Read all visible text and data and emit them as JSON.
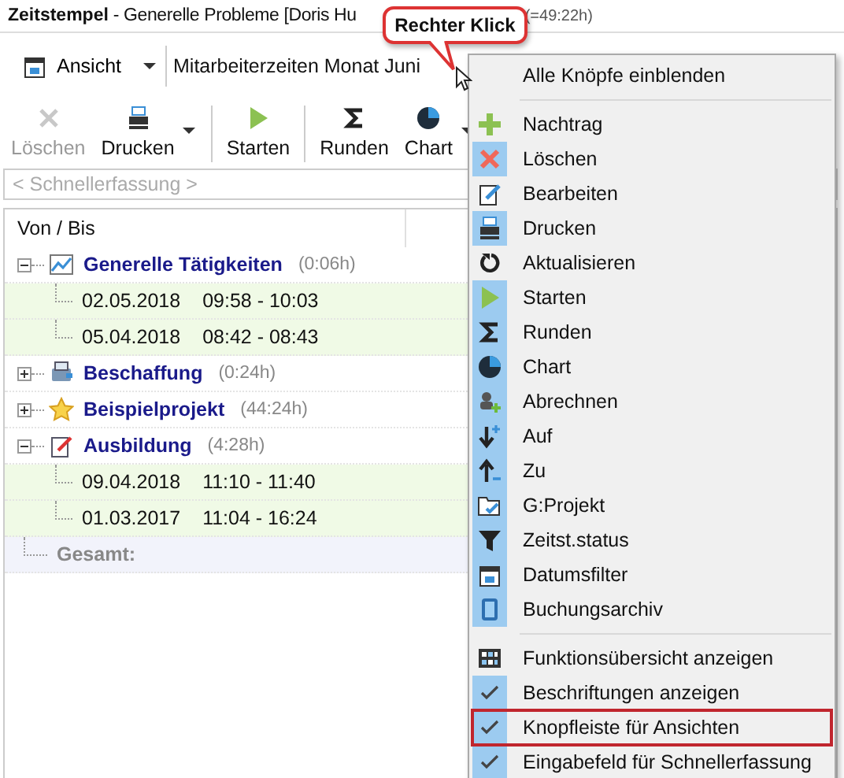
{
  "window": {
    "title": "Zeitstempel",
    "subtitle": " - Generelle Probleme [Doris Hu",
    "total": "(=49:22h)"
  },
  "callout": {
    "text": "Rechter Klick"
  },
  "view_bar": {
    "button": "Ansicht",
    "view": "Mitarbeiterzeiten Monat Juni"
  },
  "toolbar": [
    {
      "label": "Löschen",
      "disabled": true,
      "dropdown": false
    },
    {
      "label": "Drucken",
      "disabled": false,
      "dropdown": true
    },
    {
      "label": "Starten",
      "disabled": false,
      "dropdown": false
    },
    {
      "label": "Runden",
      "disabled": false,
      "dropdown": false
    },
    {
      "label": "Chart",
      "disabled": false,
      "dropdown": true
    }
  ],
  "quick_entry": {
    "placeholder": "< Schnellerfassung >"
  },
  "tree": {
    "column": "Von / Bis",
    "groups": [
      {
        "name": "Generelle Tätigkeiten",
        "duration": "(0:06h)",
        "expanded": true,
        "children": [
          {
            "date": "02.05.2018",
            "time": "09:58 - 10:03"
          },
          {
            "date": "05.04.2018",
            "time": "08:42 - 08:43"
          }
        ]
      },
      {
        "name": "Beschaffung",
        "duration": "(0:24h)",
        "expanded": false
      },
      {
        "name": "Beispielprojekt",
        "duration": "(44:24h)",
        "expanded": false
      },
      {
        "name": "Ausbildung",
        "duration": "(4:28h)",
        "expanded": true,
        "children": [
          {
            "date": "09.04.2018",
            "time": "11:10 - 11:40"
          },
          {
            "date": "01.03.2017",
            "time": "11:04 - 16:24"
          }
        ]
      }
    ],
    "total_label": "Gesamt:"
  },
  "context_menu": {
    "items": [
      {
        "kind": "command",
        "label": "Alle Knöpfe einblenden"
      },
      {
        "kind": "separator"
      },
      {
        "kind": "button",
        "label": "Nachtrag",
        "shown": false
      },
      {
        "kind": "button",
        "label": "Löschen",
        "shown": true
      },
      {
        "kind": "button",
        "label": "Bearbeiten",
        "shown": false
      },
      {
        "kind": "button",
        "label": "Drucken",
        "shown": true
      },
      {
        "kind": "button",
        "label": "Aktualisieren",
        "shown": false
      },
      {
        "kind": "button",
        "label": "Starten",
        "shown": true
      },
      {
        "kind": "button",
        "label": "Runden",
        "shown": true
      },
      {
        "kind": "button",
        "label": "Chart",
        "shown": true
      },
      {
        "kind": "button",
        "label": "Abrechnen",
        "shown": true
      },
      {
        "kind": "button",
        "label": "Auf",
        "shown": true
      },
      {
        "kind": "button",
        "label": "Zu",
        "shown": true
      },
      {
        "kind": "button",
        "label": "G:Projekt",
        "shown": true
      },
      {
        "kind": "button",
        "label": "Zeitst.status",
        "shown": true
      },
      {
        "kind": "button",
        "label": "Datumsfilter",
        "shown": true
      },
      {
        "kind": "button",
        "label": "Buchungsarchiv",
        "shown": true
      },
      {
        "kind": "separator"
      },
      {
        "kind": "overview",
        "label": "Funktionsübersicht anzeigen"
      },
      {
        "kind": "option",
        "label": "Beschriftungen anzeigen",
        "checked": true,
        "marked": false
      },
      {
        "kind": "option",
        "label": "Knopfleiste für Ansichten",
        "checked": true,
        "marked": true
      },
      {
        "kind": "option",
        "label": "Eingabefeld für Schnellerfassung",
        "checked": true,
        "marked": false
      }
    ]
  }
}
